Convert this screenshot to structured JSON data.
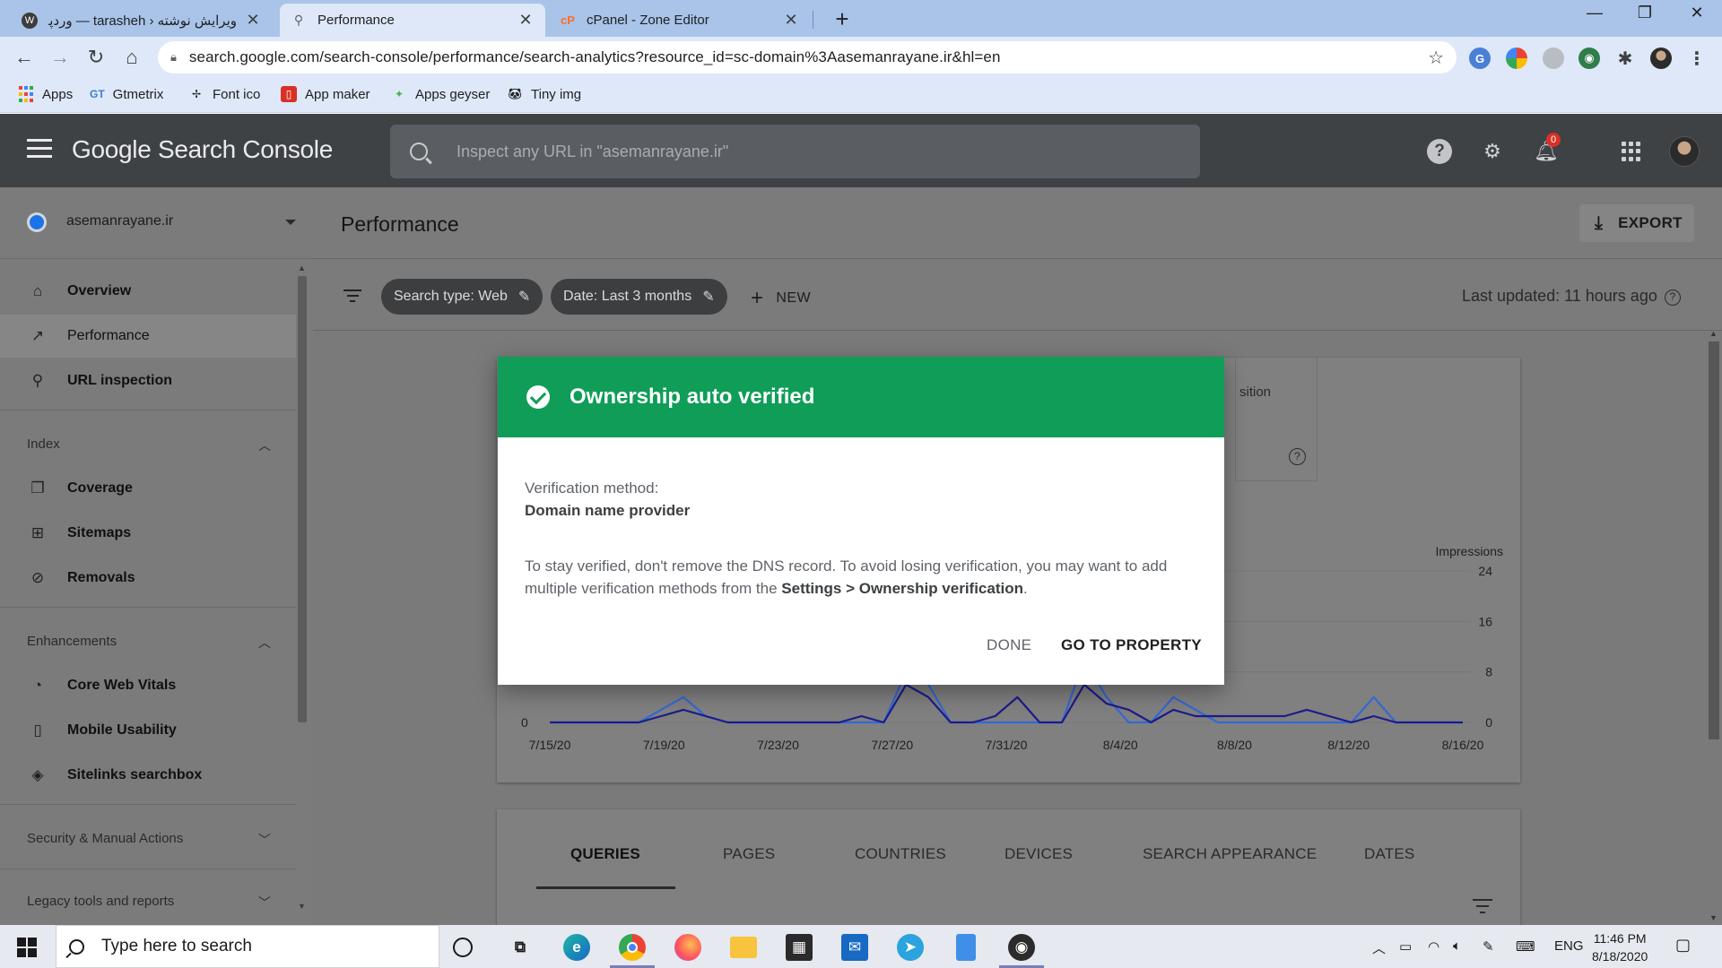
{
  "browser": {
    "tabs": [
      {
        "title": "ویرایش نوشته ‹ tarasheh — وردپر",
        "favicon": "wordpress-icon",
        "close": "✕"
      },
      {
        "title": "Performance",
        "favicon": "search-console-icon",
        "close": "✕"
      },
      {
        "title": "cPanel - Zone Editor",
        "favicon": "cpanel-icon",
        "close": "✕"
      }
    ],
    "url": "search.google.com/search-console/performance/search-analytics?resource_id=sc-domain%3Aasemanrayane.ir&hl=en",
    "bookmarks": [
      {
        "label": "Apps",
        "icon": "apps-grid-icon"
      },
      {
        "label": "Gtmetrix",
        "icon": "gtmetrix-icon",
        "abbr": "GT"
      },
      {
        "label": "Font ico",
        "icon": "font-icon"
      },
      {
        "label": "App maker",
        "icon": "app-maker-icon"
      },
      {
        "label": "Apps geyser",
        "icon": "apps-geyser-icon"
      },
      {
        "label": "Tiny img",
        "icon": "tiny-img-icon"
      }
    ]
  },
  "app": {
    "brand": "Google Search Console",
    "search_placeholder": "Inspect any URL in \"asemanrayane.ir\"",
    "notification_count": "0"
  },
  "sidebar": {
    "property": "asemanrayane.ir",
    "top_items": [
      {
        "label": "Overview",
        "icon": "home-icon"
      },
      {
        "label": "Performance",
        "icon": "trending-up-icon"
      },
      {
        "label": "URL inspection",
        "icon": "search-icon"
      }
    ],
    "index_title": "Index",
    "index_items": [
      {
        "label": "Coverage",
        "icon": "coverage-icon"
      },
      {
        "label": "Sitemaps",
        "icon": "sitemap-icon"
      },
      {
        "label": "Removals",
        "icon": "eye-off-icon"
      }
    ],
    "enh_title": "Enhancements",
    "enh_items": [
      {
        "label": "Core Web Vitals",
        "icon": "speedometer-icon"
      },
      {
        "label": "Mobile Usability",
        "icon": "phone-icon"
      },
      {
        "label": "Sitelinks searchbox",
        "icon": "layers-icon"
      }
    ],
    "security_title": "Security & Manual Actions",
    "legacy_title": "Legacy tools and reports"
  },
  "main": {
    "title": "Performance",
    "export_label": "EXPORT",
    "chip_search_type": "Search type: Web",
    "chip_date": "Date: Last 3 months",
    "new_label": "NEW",
    "last_updated": "Last updated: 11 hours ago",
    "metric_partial_label": "sition",
    "tabs": [
      "QUERIES",
      "PAGES",
      "COUNTRIES",
      "DEVICES",
      "SEARCH APPEARANCE",
      "DATES"
    ]
  },
  "chart_data": {
    "type": "line",
    "ylabel": "Impressions",
    "y_ticks": [
      0,
      8,
      16,
      24
    ],
    "left_ticks": [
      "0"
    ],
    "x_ticks": [
      "7/15/20",
      "7/19/20",
      "7/23/20",
      "7/27/20",
      "7/31/20",
      "8/4/20",
      "8/8/20",
      "8/12/20",
      "8/16/20"
    ],
    "ylim": [
      0,
      24
    ],
    "colors": {
      "series_a": "#1c1c8a",
      "series_b": "#3367d6"
    },
    "series_a_values": [
      0,
      0,
      0,
      0,
      0,
      1,
      2,
      1,
      0,
      0,
      0,
      0,
      0,
      0,
      1,
      0,
      6,
      4,
      0,
      0,
      1,
      4,
      0,
      0,
      6,
      3,
      2,
      0,
      2,
      1,
      1,
      1,
      1,
      1,
      2,
      1,
      0,
      1,
      0,
      0,
      0,
      0
    ],
    "series_b_values": [
      0,
      0,
      0,
      0,
      0,
      2,
      4,
      1,
      0,
      0,
      0,
      0,
      0,
      0,
      0,
      0,
      8,
      6,
      0,
      0,
      0,
      0,
      0,
      0,
      10,
      4,
      0,
      0,
      4,
      2,
      0,
      0,
      0,
      0,
      0,
      0,
      0,
      4,
      0,
      0,
      0,
      0
    ]
  },
  "dialog": {
    "title": "Ownership auto verified",
    "method_label": "Verification method:",
    "method_value": "Domain name provider",
    "message_before": "To stay verified, don't remove the DNS record. To avoid losing verification, you may want to add multiple verification methods from the ",
    "message_link": "Settings > Ownership verification",
    "message_after": ".",
    "done_label": "DONE",
    "go_label": "GO TO PROPERTY"
  },
  "taskbar": {
    "search_placeholder": "Type here to search",
    "tray_lang": "ENG",
    "time": "11:46 PM",
    "date": "8/18/2020"
  }
}
